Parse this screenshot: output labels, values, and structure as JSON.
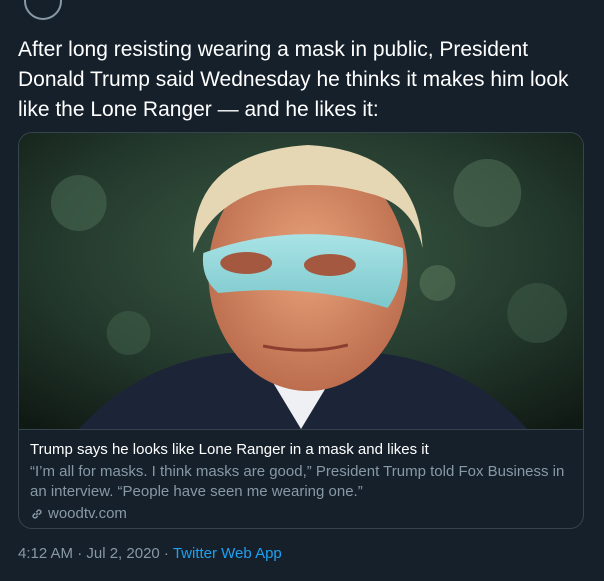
{
  "tweet": {
    "text": "After long resisting wearing a mask in public, President Donald Trump said Wednesday he thinks it makes him look like the Lone Ranger — and he likes it:"
  },
  "card": {
    "title": "Trump says he looks like Lone Ranger in a mask and likes it",
    "description": "“I’m all for masks. I think masks are good,” President Trump told Fox Business in an interview. “People have seen me wearing one.”",
    "source": "woodtv.com",
    "source_icon": "link-icon"
  },
  "meta": {
    "timestamp": "4:12 AM · Jul 2, 2020 · ",
    "app": "Twitter Web App"
  },
  "colors": {
    "background": "#15202b",
    "accent": "#1da1f2",
    "muted": "#8899a6",
    "border": "#38444d"
  }
}
